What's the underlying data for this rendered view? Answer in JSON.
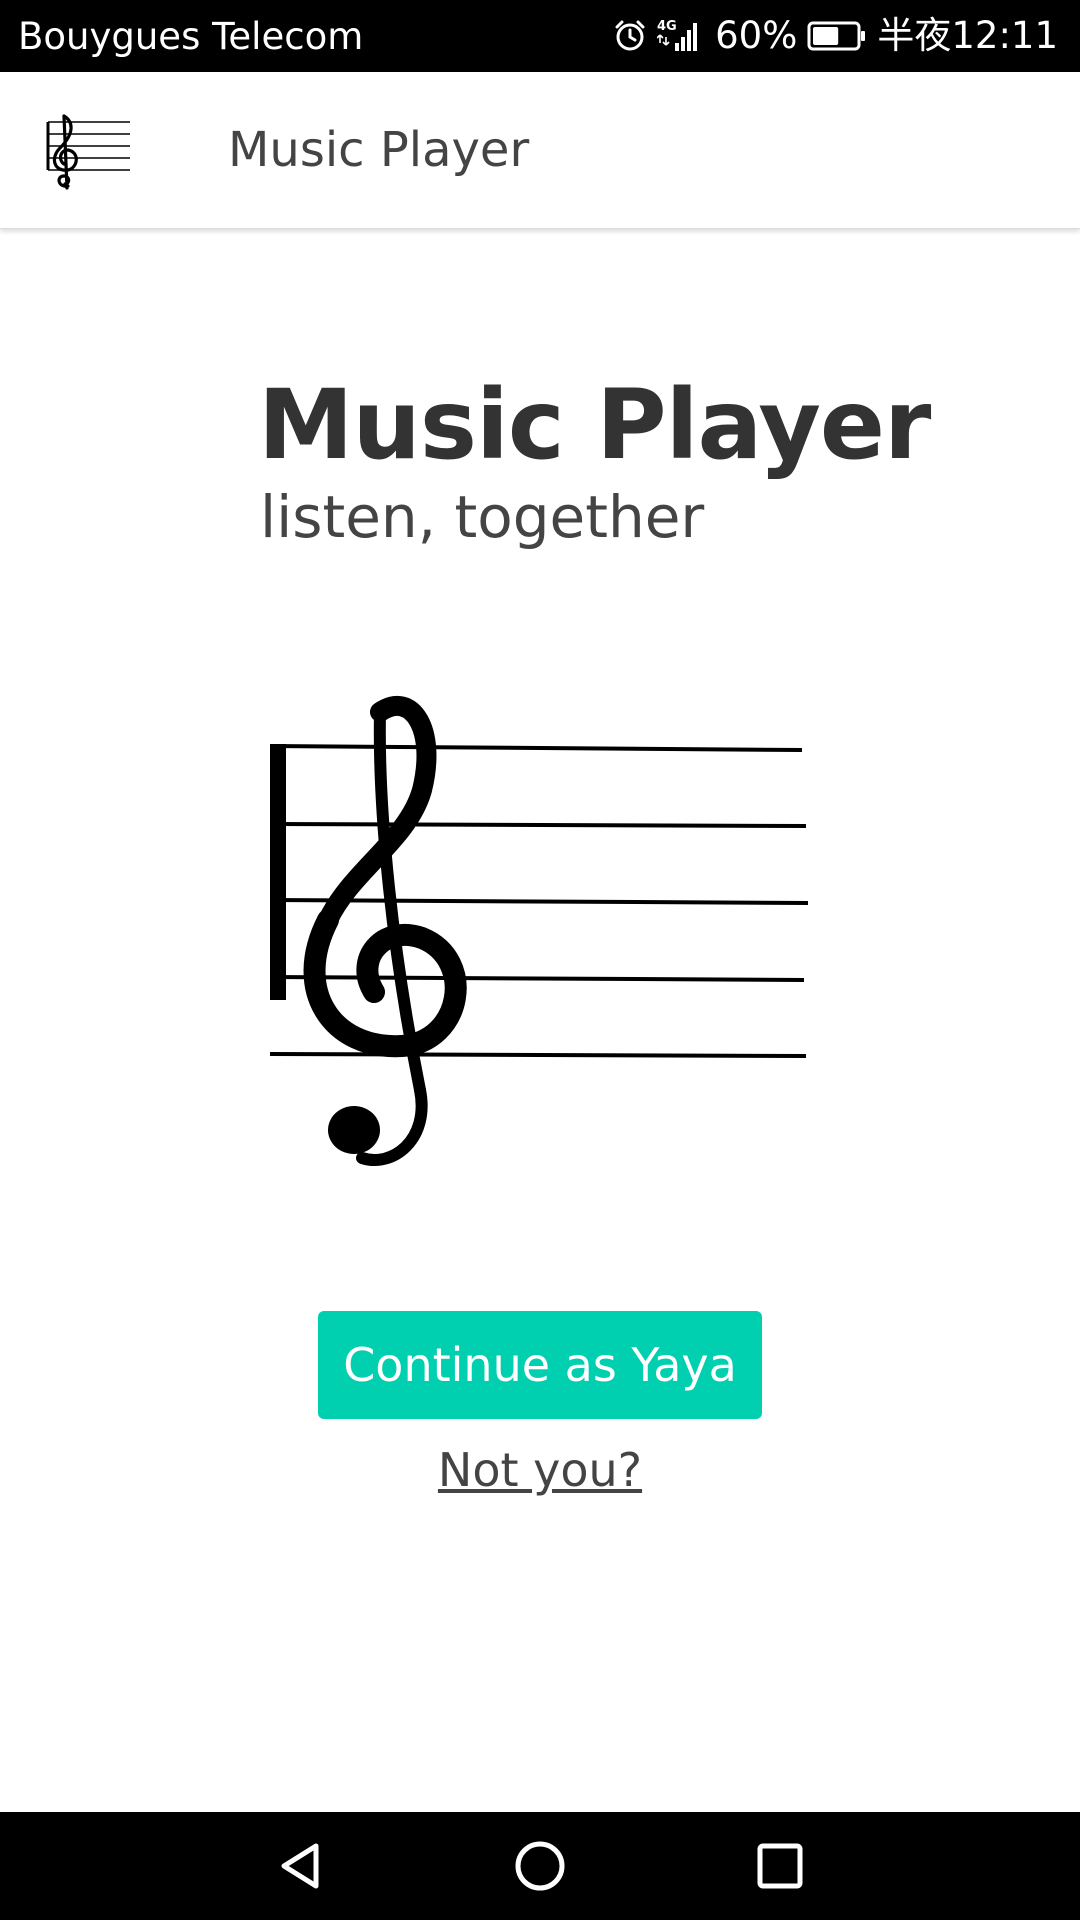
{
  "status_bar": {
    "carrier": "Bouygues Telecom",
    "network": "4G",
    "battery_percent": "60%",
    "battery_level": 0.6,
    "time": "半夜12:11",
    "icons": [
      "alarm-icon",
      "signal-icon",
      "battery-icon"
    ]
  },
  "app_bar": {
    "title": "Music Player",
    "logo_icon": "treble-clef-staff-icon"
  },
  "hero": {
    "title": "Music Player",
    "subtitle": "listen, together",
    "illustration_icon": "treble-clef-staff-icon"
  },
  "actions": {
    "continue_label": "Continue as Yaya",
    "not_you_label": "Not you?"
  },
  "nav_bar": {
    "icons": [
      "back-icon",
      "home-icon",
      "recents-icon"
    ]
  },
  "colors": {
    "accent": "#00cfb0",
    "status_bar_bg": "#000000",
    "nav_bar_bg": "#000000",
    "text_dark": "#333333"
  }
}
